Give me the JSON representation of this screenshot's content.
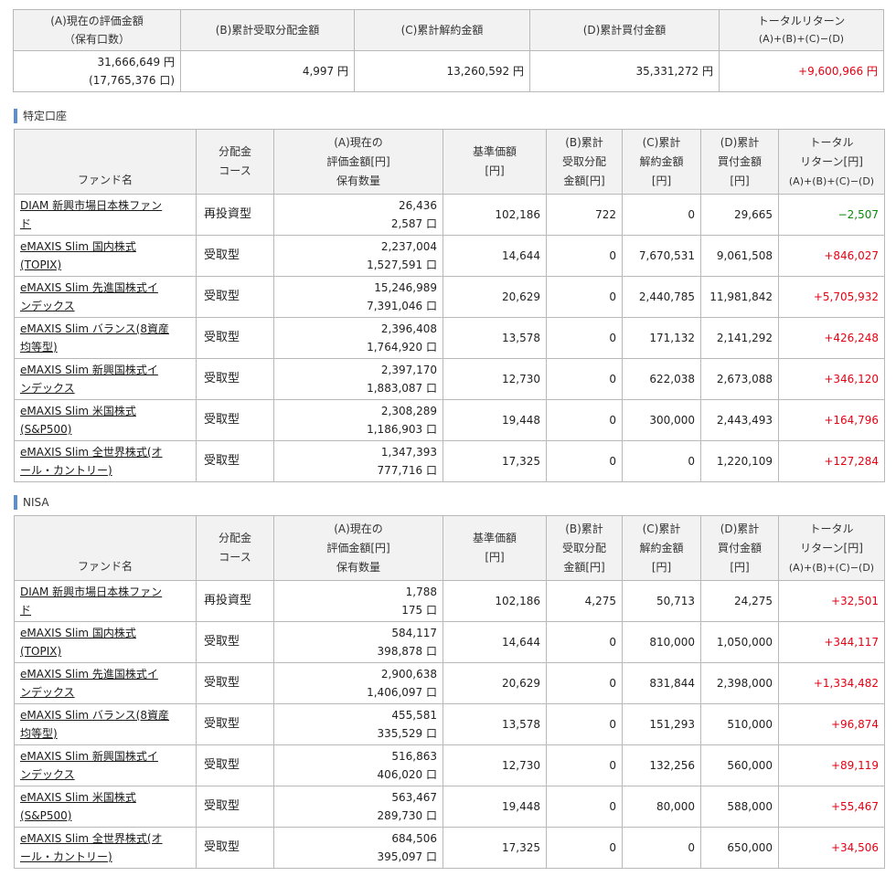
{
  "summary": {
    "headers": {
      "a_line1": "(A)現在の評価金額",
      "a_line2": "（保有口数）",
      "b": "(B)累計受取分配金額",
      "c": "(C)累計解約金額",
      "d": "(D)累計買付金額",
      "total_line1": "トータルリターン",
      "total_line2": "(A)+(B)+(C)−(D)"
    },
    "values": {
      "a_amount": "31,666,649 円",
      "a_units": "(17,765,376 口)",
      "b": "4,997 円",
      "c": "13,260,592 円",
      "d": "35,331,272 円",
      "total": "+9,600,966 円"
    }
  },
  "columns": {
    "fund": "ファンド名",
    "course_l1": "分配金",
    "course_l2": "コース",
    "value_l1": "(A)現在の",
    "value_l2": "評価金額[円]",
    "value_l3": "保有数量",
    "nav_l1": "基準価額",
    "nav_l2": "[円]",
    "b_l1": "(B)累計",
    "b_l2": "受取分配",
    "b_l3": "金額[円]",
    "c_l1": "(C)累計",
    "c_l2": "解約金額",
    "c_l3": "[円]",
    "d_l1": "(D)累計",
    "d_l2": "買付金額",
    "d_l3": "[円]",
    "tr_l1": "トータル",
    "tr_l2": "リターン[円]",
    "tr_l3": "(A)+(B)+(C)−(D)"
  },
  "tokutei": {
    "title": "特定口座",
    "rows": [
      {
        "name1": "DIAM 新興市場日本株ファン",
        "name2": "ド",
        "course": "再投資型",
        "value": "26,436",
        "units": "2,587 口",
        "nav": "102,186",
        "b": "722",
        "c": "0",
        "d": "29,665",
        "total": "−2,507",
        "sign": "neg"
      },
      {
        "name1": "eMAXIS Slim 国内株式",
        "name2": "(TOPIX)",
        "course": "受取型",
        "value": "2,237,004",
        "units": "1,527,591 口",
        "nav": "14,644",
        "b": "0",
        "c": "7,670,531",
        "d": "9,061,508",
        "total": "+846,027",
        "sign": "pos"
      },
      {
        "name1": "eMAXIS Slim 先進国株式イ",
        "name2": "ンデックス",
        "course": "受取型",
        "value": "15,246,989",
        "units": "7,391,046 口",
        "nav": "20,629",
        "b": "0",
        "c": "2,440,785",
        "d": "11,981,842",
        "total": "+5,705,932",
        "sign": "pos"
      },
      {
        "name1": "eMAXIS Slim バランス(8資産",
        "name2": "均等型)",
        "course": "受取型",
        "value": "2,396,408",
        "units": "1,764,920 口",
        "nav": "13,578",
        "b": "0",
        "c": "171,132",
        "d": "2,141,292",
        "total": "+426,248",
        "sign": "pos"
      },
      {
        "name1": "eMAXIS Slim 新興国株式イ",
        "name2": "ンデックス",
        "course": "受取型",
        "value": "2,397,170",
        "units": "1,883,087 口",
        "nav": "12,730",
        "b": "0",
        "c": "622,038",
        "d": "2,673,088",
        "total": "+346,120",
        "sign": "pos"
      },
      {
        "name1": "eMAXIS Slim 米国株式",
        "name2": "(S&P500)",
        "course": "受取型",
        "value": "2,308,289",
        "units": "1,186,903 口",
        "nav": "19,448",
        "b": "0",
        "c": "300,000",
        "d": "2,443,493",
        "total": "+164,796",
        "sign": "pos"
      },
      {
        "name1": "eMAXIS Slim 全世界株式(オ",
        "name2": "ール・カントリー)",
        "course": "受取型",
        "value": "1,347,393",
        "units": "777,716 口",
        "nav": "17,325",
        "b": "0",
        "c": "0",
        "d": "1,220,109",
        "total": "+127,284",
        "sign": "pos"
      }
    ]
  },
  "nisa": {
    "title": "NISA",
    "rows": [
      {
        "name1": "DIAM 新興市場日本株ファン",
        "name2": "ド",
        "course": "再投資型",
        "value": "1,788",
        "units": "175 口",
        "nav": "102,186",
        "b": "4,275",
        "c": "50,713",
        "d": "24,275",
        "total": "+32,501",
        "sign": "pos"
      },
      {
        "name1": "eMAXIS Slim 国内株式",
        "name2": "(TOPIX)",
        "course": "受取型",
        "value": "584,117",
        "units": "398,878 口",
        "nav": "14,644",
        "b": "0",
        "c": "810,000",
        "d": "1,050,000",
        "total": "+344,117",
        "sign": "pos"
      },
      {
        "name1": "eMAXIS Slim 先進国株式イ",
        "name2": "ンデックス",
        "course": "受取型",
        "value": "2,900,638",
        "units": "1,406,097 口",
        "nav": "20,629",
        "b": "0",
        "c": "831,844",
        "d": "2,398,000",
        "total": "+1,334,482",
        "sign": "pos"
      },
      {
        "name1": "eMAXIS Slim バランス(8資産",
        "name2": "均等型)",
        "course": "受取型",
        "value": "455,581",
        "units": "335,529 口",
        "nav": "13,578",
        "b": "0",
        "c": "151,293",
        "d": "510,000",
        "total": "+96,874",
        "sign": "pos"
      },
      {
        "name1": "eMAXIS Slim 新興国株式イ",
        "name2": "ンデックス",
        "course": "受取型",
        "value": "516,863",
        "units": "406,020 口",
        "nav": "12,730",
        "b": "0",
        "c": "132,256",
        "d": "560,000",
        "total": "+89,119",
        "sign": "pos"
      },
      {
        "name1": "eMAXIS Slim 米国株式",
        "name2": "(S&P500)",
        "course": "受取型",
        "value": "563,467",
        "units": "289,730 口",
        "nav": "19,448",
        "b": "0",
        "c": "80,000",
        "d": "588,000",
        "total": "+55,467",
        "sign": "pos"
      },
      {
        "name1": "eMAXIS Slim 全世界株式(オ",
        "name2": "ール・カントリー)",
        "course": "受取型",
        "value": "684,506",
        "units": "395,097 口",
        "nav": "17,325",
        "b": "0",
        "c": "0",
        "d": "650,000",
        "total": "+34,506",
        "sign": "pos"
      }
    ]
  },
  "colors": {
    "positive": "#e60012",
    "negative": "#0a8a0a",
    "accent": "#5a8fd0"
  }
}
